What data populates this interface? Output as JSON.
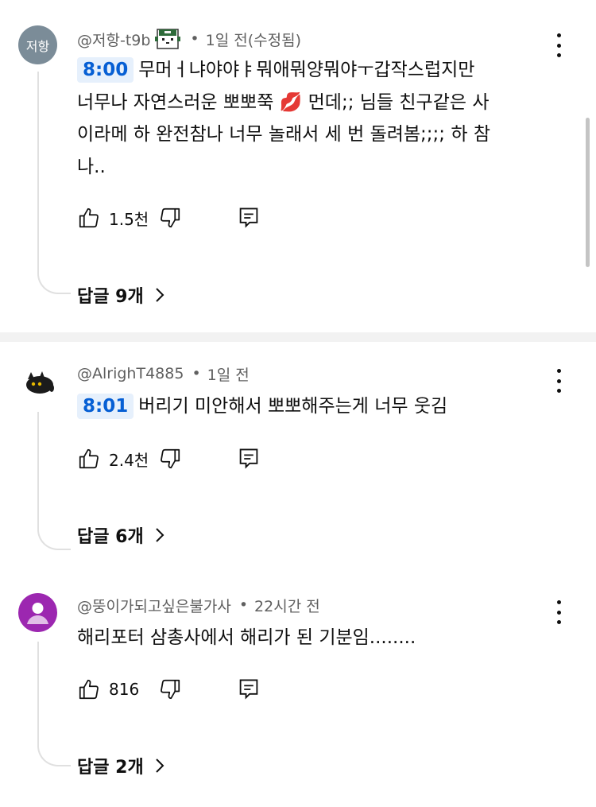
{
  "comments": [
    {
      "avatar_text": "저항",
      "author": "@저항-t9b",
      "time": "1일 전(수정됨)",
      "timestamp": "8:00",
      "lines": [
        "무머ㅓ냐야야ㅑ뭐애뭐양뭐야ㅜ갑작스럽지만",
        "너무나 자연스러운 뽀뽀쭉 💋 먼데;; 님들 친구같은 사",
        "이라메 하 완전참나 너무 놀래서 세 번 돌려봄;;;; 하 참",
        "나.."
      ],
      "likes": "1.5천",
      "replies": "답글 9개"
    },
    {
      "author": "@AlrighT4885",
      "time": "1일 전",
      "timestamp": "8:01",
      "lines": [
        "버리기 미안해서 뽀뽀해주는게 너무 웃김"
      ],
      "likes": "2.4천",
      "replies": "답글 6개"
    },
    {
      "author": "@뚱이가되고싶은불가사",
      "time": "22시간 전",
      "lines": [
        "해리포터 삼총사에서 해리가 된 기분임........"
      ],
      "likes": "816",
      "replies": "답글 2개"
    }
  ],
  "separator": "•",
  "icons": [
    "thumbs-up-icon",
    "thumbs-down-icon",
    "reply-icon",
    "more-vert-icon",
    "chevron-right-icon"
  ],
  "colors": {
    "timestamp_bg": "#e6f0fc",
    "timestamp_text": "#065fd4",
    "meta_text": "#606060"
  }
}
